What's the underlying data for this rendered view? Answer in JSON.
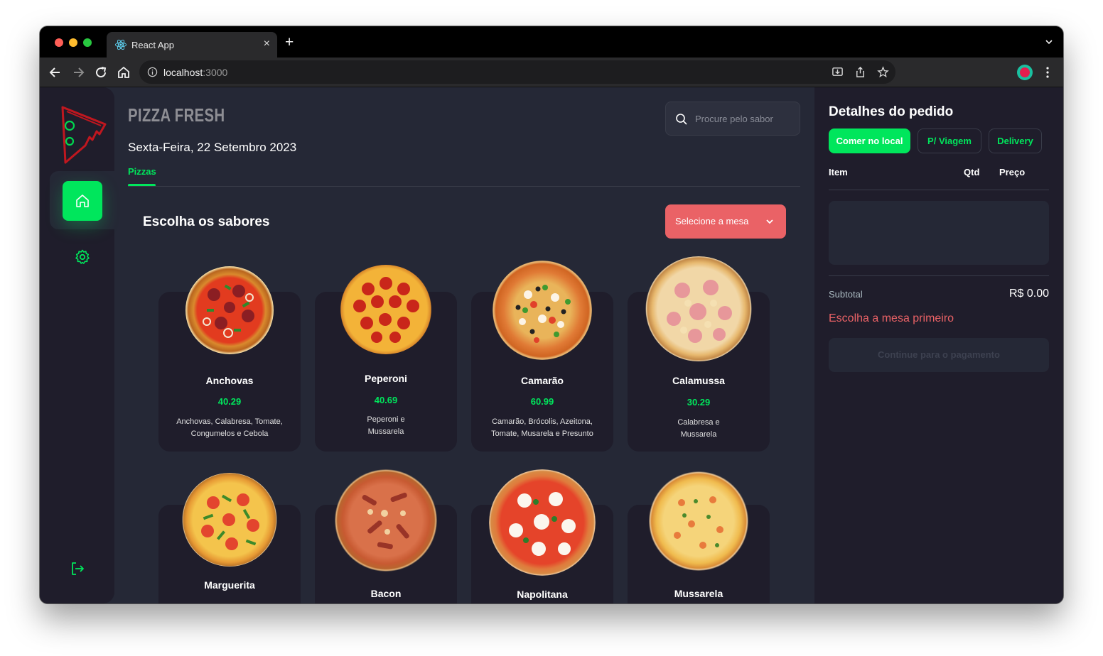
{
  "browser": {
    "tab_title": "React App",
    "tab_close": "×",
    "new_tab": "+",
    "url_host": "localhost",
    "url_port": ":3000"
  },
  "app": {
    "brand": "PIZZA FRESH",
    "date": "Sexta-Feira, 22 Setembro 2023",
    "category_tab": "Pizzas",
    "search_placeholder": "Procure pelo sabor",
    "section_title": "Escolha os sabores",
    "table_select_label": "Selecione a mesa",
    "accent_color": "#00e65c",
    "danger_color": "#ea6266"
  },
  "pizzas": [
    {
      "name": "Anchovas",
      "price": "40.29",
      "description": "Anchovas, Calabresa, Tomate, Congumelos e Cebola"
    },
    {
      "name": "Peperoni",
      "price": "40.69",
      "description": "Peperoni e Mussarela"
    },
    {
      "name": "Camarão",
      "price": "60.99",
      "description": "Camarão, Brócolis, Azeitona, Tomate, Musarela e Presunto"
    },
    {
      "name": "Calamussa",
      "price": "30.29",
      "description": "Calabresa e Mussarela"
    },
    {
      "name": "Marguerita"
    },
    {
      "name": "Bacon"
    },
    {
      "name": "Napolitana"
    },
    {
      "name": "Mussarela"
    }
  ],
  "order": {
    "title": "Detalhes do pedido",
    "modes": [
      "Comer no local",
      "P/ Viagem",
      "Delivery"
    ],
    "active_mode": "Comer no local",
    "col_item": "Item",
    "col_qty": "Qtd",
    "col_price": "Preço",
    "subtotal_label": "Subtotal",
    "subtotal_value": "R$ 0.00",
    "warning": "Escolha a mesa primeiro",
    "pay_button": "Continue para o pagamento"
  }
}
